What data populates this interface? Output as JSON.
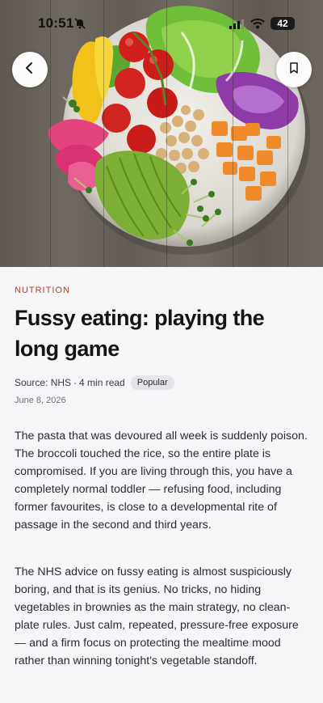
{
  "status": {
    "time": "10:51",
    "battery": "42"
  },
  "header": {
    "back_icon": "chevron-left-icon",
    "bookmark_icon": "bookmark-icon"
  },
  "hero": {
    "image": "salad-bowl-photo"
  },
  "article": {
    "category": "NUTRITION",
    "title": "Fussy eating: playing the long game",
    "source": "Source: NHS",
    "separator": "·",
    "read_time": "4 min read",
    "badge": "Popular",
    "date": "June 8, 2026",
    "paragraphs": [
      "The pasta that was devoured all week is suddenly poison. The broccoli touched the rice, so the entire plate is compromised. If you are living through this, you have a completely normal toddler — refusing food, including former favourites, is close to a developmental rite of passage in the second and third years.",
      "The NHS advice on fussy eating is almost suspiciously boring, and that is its genius. No tricks, no hiding vegetables in brownies as the main strategy, no clean-plate rules. Just calm, repeated, pressure-free exposure — and a firm focus on protecting the mealtime mood rather than winning tonight's vegetable standoff."
    ]
  },
  "colors": {
    "accent": "#b2412a",
    "background": "#f6f6f8",
    "badge_bg": "#e4e4e9"
  }
}
